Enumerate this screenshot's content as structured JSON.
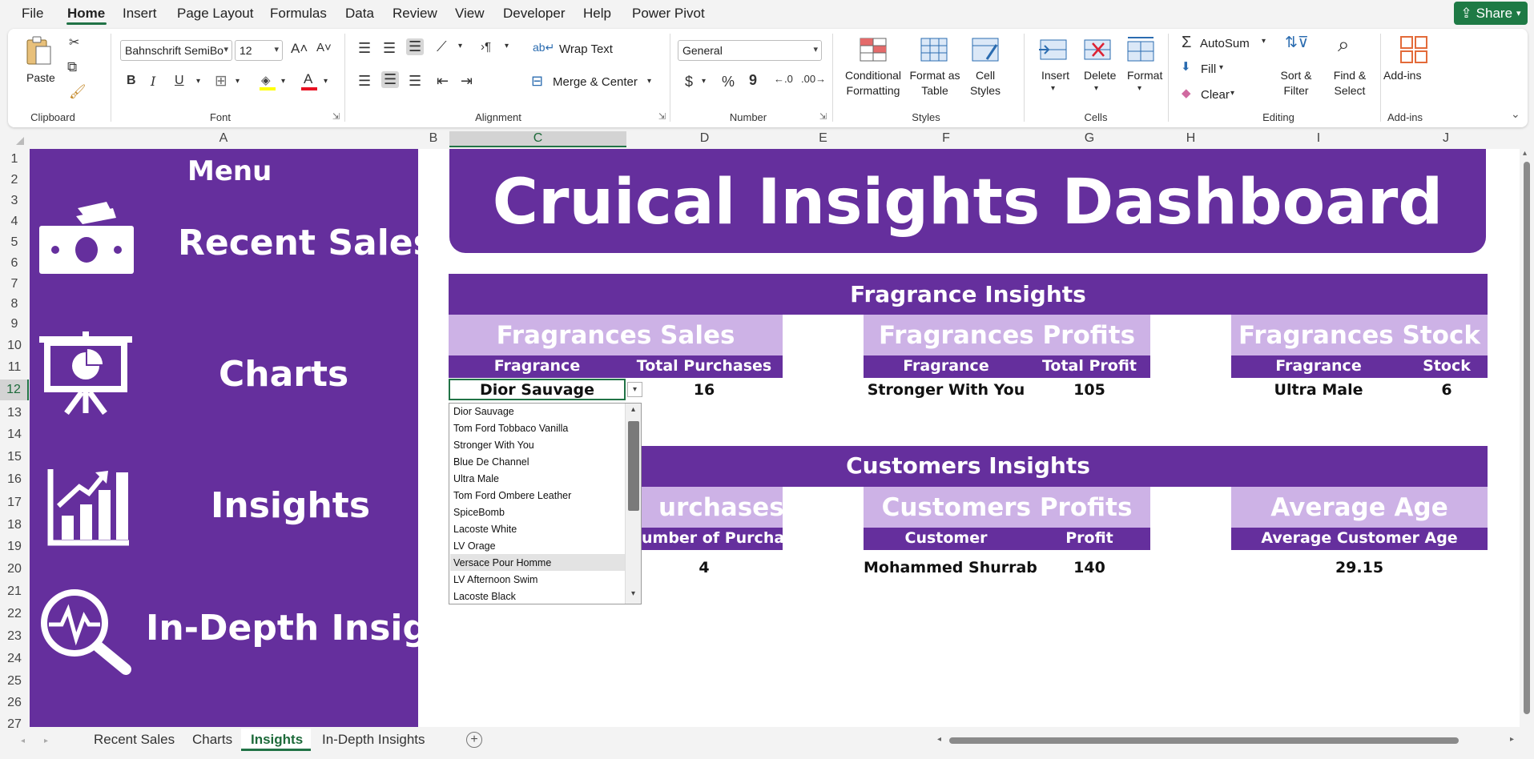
{
  "menubar": {
    "tabs": [
      "File",
      "Home",
      "Insert",
      "Page Layout",
      "Formulas",
      "Data",
      "Review",
      "View",
      "Developer",
      "Help",
      "Power Pivot"
    ],
    "share_label": "Share"
  },
  "ribbon": {
    "clipboard": {
      "paste_label": "Paste",
      "group_label": "Clipboard"
    },
    "font": {
      "font_name": "Bahnschrift SemiBo",
      "font_size": "12",
      "group_label": "Font",
      "font_color": "#e81123",
      "highlight_color": "#ffff00"
    },
    "alignment": {
      "wrap_text_label": "Wrap Text",
      "merge_label": "Merge & Center",
      "group_label": "Alignment"
    },
    "number": {
      "format": "General",
      "group_label": "Number",
      "currency_symbol": "$",
      "percent_symbol": "%",
      "comma_symbol": "9"
    },
    "styles": {
      "conditional_1": "Conditional",
      "conditional_2": "Formatting",
      "format_table_1": "Format as",
      "format_table_2": "Table",
      "cell_styles_1": "Cell",
      "cell_styles_2": "Styles",
      "group_label": "Styles"
    },
    "cells": {
      "insert_label": "Insert",
      "delete_label": "Delete",
      "format_label": "Format",
      "group_label": "Cells"
    },
    "editing": {
      "autosum_label": "AutoSum",
      "fill_label": "Fill",
      "clear_label": "Clear",
      "sort_1": "Sort &",
      "sort_2": "Filter",
      "find_1": "Find &",
      "find_2": "Select",
      "group_label": "Editing"
    },
    "addins": {
      "label": "Add-ins",
      "group_label": "Add-ins"
    }
  },
  "grid": {
    "columns": [
      "A",
      "B",
      "C",
      "D",
      "E",
      "F",
      "G",
      "H",
      "I",
      "J"
    ],
    "rows": [
      "1",
      "2",
      "3",
      "4",
      "5",
      "6",
      "7",
      "8",
      "9",
      "10",
      "11",
      "12",
      "13",
      "14",
      "15",
      "16",
      "17",
      "18",
      "19",
      "20",
      "21",
      "22",
      "23",
      "24",
      "25",
      "26",
      "27"
    ],
    "selected_column": "C",
    "selected_row": "12"
  },
  "menu": {
    "title": "Menu",
    "items": [
      "Recent Sales",
      "Charts",
      "Insights",
      "In-Depth Insights"
    ]
  },
  "dashboard": {
    "title": "Cruical Insights Dashboard",
    "fragrance_section": "Fragrance Insights",
    "sales": {
      "title": "Fragrances Sales",
      "col1": "Fragrance",
      "col2": "Total Purchases",
      "value1": "Dior Sauvage",
      "value2": "16"
    },
    "profits": {
      "title": "Fragrances Profits",
      "col1": "Fragrance",
      "col2": "Total Profit",
      "value1": "Stronger With You",
      "value2": "105"
    },
    "stock": {
      "title": "Fragrances Stock",
      "col1": "Fragrance",
      "col2": "Stock",
      "value1": "Ultra Male",
      "value2": "6"
    },
    "customer_section": "Customers Insights",
    "cust_purchases": {
      "title": "urchases",
      "col2": "umber of Purchases",
      "value2": "4"
    },
    "cust_profits": {
      "title": "Customers Profits",
      "col1": "Customer",
      "col2": "Profit",
      "value1": "Mohammed Shurrab",
      "value2": "140"
    },
    "avg_age": {
      "title": "Average Age",
      "col1": "Average Customer Age",
      "value1": "29.15"
    }
  },
  "dropdown": {
    "items": [
      "Dior Sauvage",
      "Tom Ford Tobbaco Vanilla",
      "Stronger With You",
      "Blue De Channel",
      "Ultra Male",
      "Tom Ford Ombere Leather",
      "SpiceBomb",
      "Lacoste White",
      "LV Orage",
      "Versace Pour Homme",
      "LV Afternoon Swim",
      "Lacoste Black"
    ],
    "highlighted": "Versace Pour Homme"
  },
  "sheet_tabs": {
    "tabs": [
      "Recent Sales",
      "Charts",
      "Insights",
      "In-Depth Insights"
    ],
    "active": "Insights"
  },
  "colors": {
    "purple": "#652f9d",
    "light_purple": "#cdb2e6",
    "excel_green": "#217346"
  }
}
